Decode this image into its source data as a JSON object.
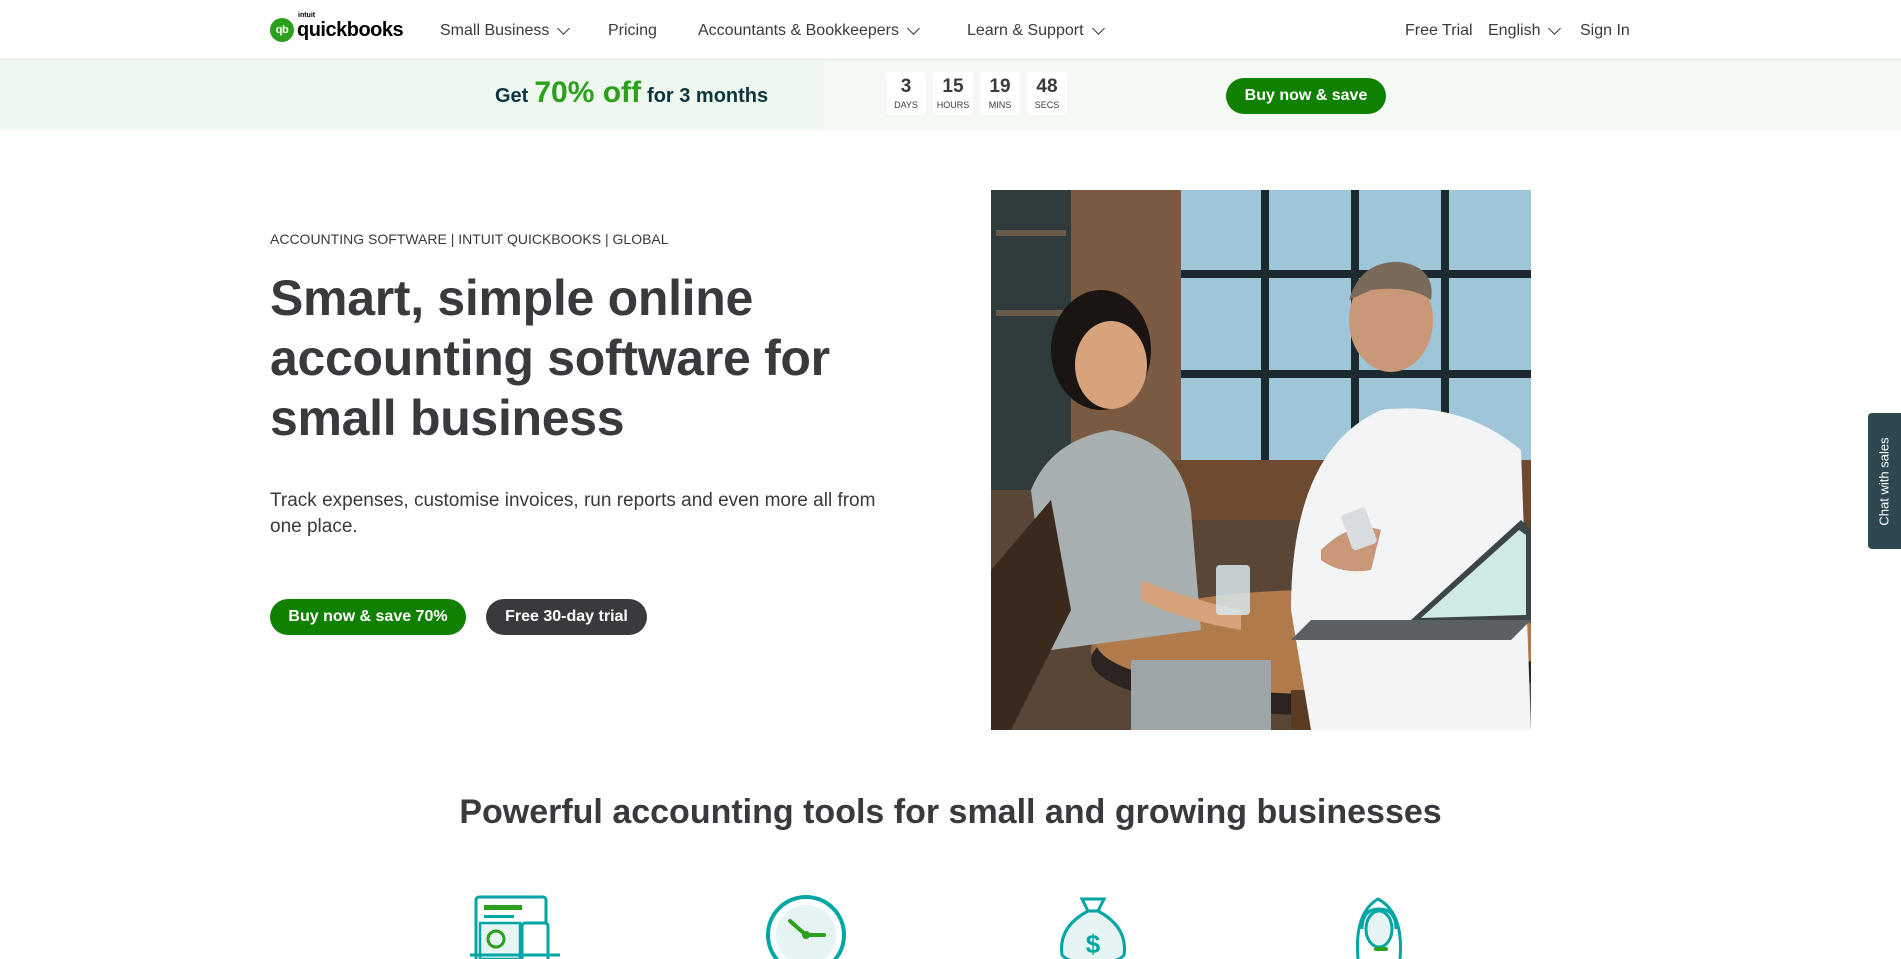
{
  "nav": {
    "logo_small": "intuit",
    "logo_name": "quickbooks",
    "logo_mark": "qb",
    "items": [
      {
        "label": "Small Business",
        "has_dropdown": true
      },
      {
        "label": "Pricing",
        "has_dropdown": false
      },
      {
        "label": "Accountants & Bookkeepers",
        "has_dropdown": true
      },
      {
        "label": "Learn & Support",
        "has_dropdown": true
      }
    ],
    "right": {
      "free_trial": "Free Trial",
      "language": "English",
      "sign_in": "Sign In"
    }
  },
  "promo": {
    "prefix": "Get",
    "highlight": "70% off",
    "suffix": "for 3 months",
    "countdown": [
      {
        "value": "3",
        "unit": "DAYS"
      },
      {
        "value": "15",
        "unit": "HOURS"
      },
      {
        "value": "19",
        "unit": "MINS"
      },
      {
        "value": "48",
        "unit": "SECS"
      }
    ],
    "button": "Buy now & save"
  },
  "hero": {
    "eyebrow": "ACCOUNTING SOFTWARE | INTUIT QUICKBOOKS | GLOBAL",
    "title": "Smart, simple online accounting software for small business",
    "description": "Track expenses, customise invoices, run reports and even more all from one place.",
    "primary_button": "Buy now & save 70%",
    "secondary_button": "Free 30-day trial"
  },
  "chat": {
    "label": "Chat with sales"
  },
  "features": {
    "title": "Powerful accounting tools for small and growing businesses",
    "icons": [
      "invoice-devices-icon",
      "clock-icon",
      "money-bag-icon",
      "support-agent-icon"
    ]
  },
  "colors": {
    "brand_green": "#2ca01c",
    "button_green": "#108000",
    "text_dark": "#393a3d",
    "teal_icon": "#00a6a4",
    "chat_tab": "#2e4851"
  }
}
